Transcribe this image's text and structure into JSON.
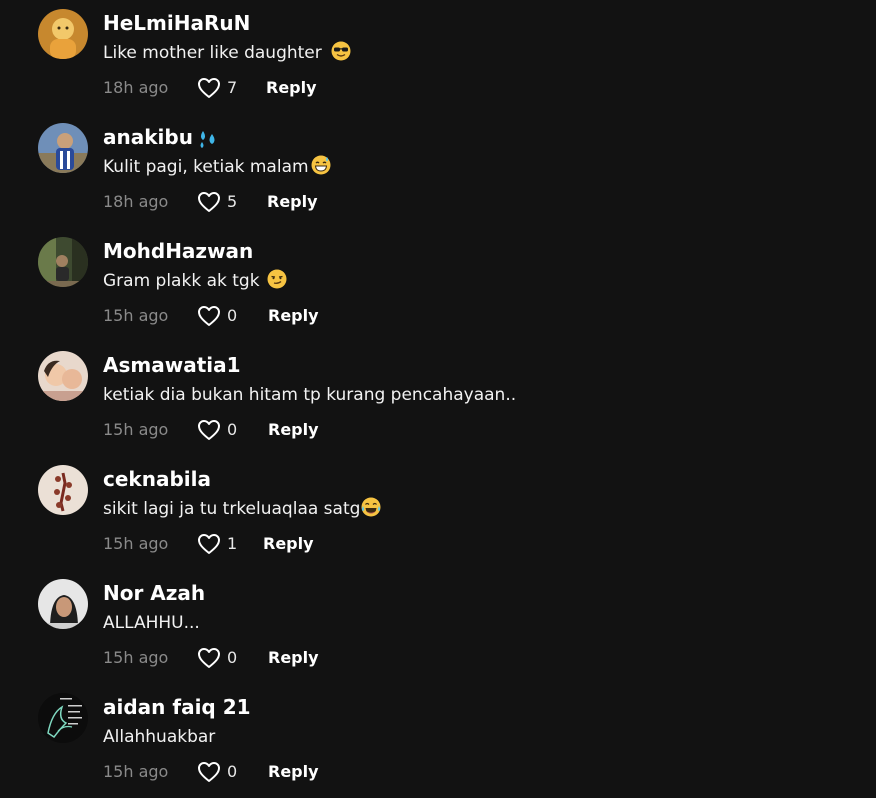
{
  "comments": [
    {
      "username": "HeLmiHaRuN",
      "text": "Like mother like daughter",
      "emoji": "cool-face-emoji",
      "time": "18h ago",
      "likes": "7",
      "reply": "Reply",
      "avatar_color": "#d89a3c",
      "avatar_accent": "#f2c86a"
    },
    {
      "username": "anakibu",
      "text": "Kulit pagi, ketiak malam",
      "emoji": "grin-sweat-emoji",
      "time": "18h ago",
      "likes": "5",
      "reply": "Reply",
      "badge": "sweat-droplets-icon",
      "avatar_color": "#5a7ea8",
      "avatar_accent": "#9bbcd8"
    },
    {
      "username": "MohdHazwan",
      "text": "Gram plakk ak tgk",
      "emoji": "smirk-emoji",
      "time": "15h ago",
      "likes": "0",
      "reply": "Reply",
      "avatar_color": "#4e5e3a",
      "avatar_accent": "#8a8060"
    },
    {
      "username": "Asmawatia1",
      "text": "ketiak dia bukan hitam tp kurang pencahayaan..",
      "time": "15h ago",
      "likes": "0",
      "reply": "Reply",
      "avatar_color": "#d8b8a8",
      "avatar_accent": "#f0dcd0"
    },
    {
      "username": "ceknabila",
      "text": "sikit lagi ja tu trkeluaqlaa satg",
      "emoji": "tears-of-joy-emoji",
      "time": "15h ago",
      "likes": "1",
      "reply": "Reply",
      "avatar_color": "#e8ddd2",
      "avatar_accent": "#8a3a2a"
    },
    {
      "username": "Nor Azah",
      "text": "ALLAHHU...",
      "time": "15h ago",
      "likes": "0",
      "reply": "Reply",
      "avatar_color": "#e6e6e6",
      "avatar_accent": "#1e1e1e"
    },
    {
      "username": "aidan faiq 21",
      "text": "Allahhuakbar",
      "time": "15h ago",
      "likes": "0",
      "reply": "Reply",
      "avatar_color": "#0c0c0c",
      "avatar_accent": "#7fd8c0"
    }
  ],
  "colors": {
    "background": "#121212",
    "text": "#ffffff",
    "muted": "#8a8a8a",
    "emoji_yellow": "#f6c342"
  }
}
